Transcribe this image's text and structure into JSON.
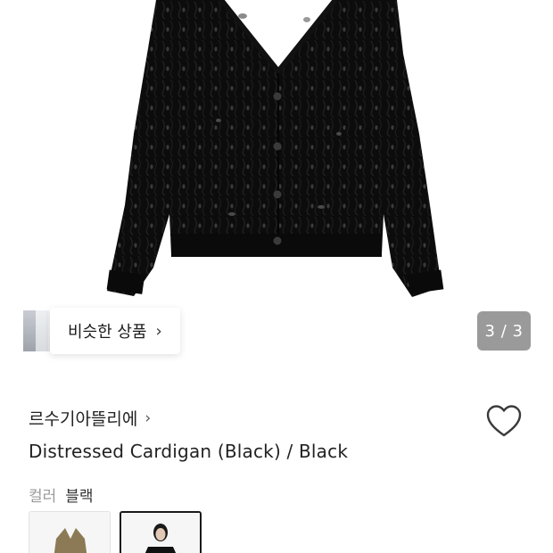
{
  "gallery": {
    "similar_label": "비슷한 상품",
    "counter": "3 / 3"
  },
  "product": {
    "brand": "르수기아뜰리에",
    "title": "Distressed Cardigan (Black) / Black",
    "color_label": "컬러",
    "color_value": "블랙"
  },
  "icons": {
    "similar_chevron": "chevron-right-icon",
    "brand_chevron": "chevron-right-icon",
    "wishlist": "heart-outline-icon"
  }
}
